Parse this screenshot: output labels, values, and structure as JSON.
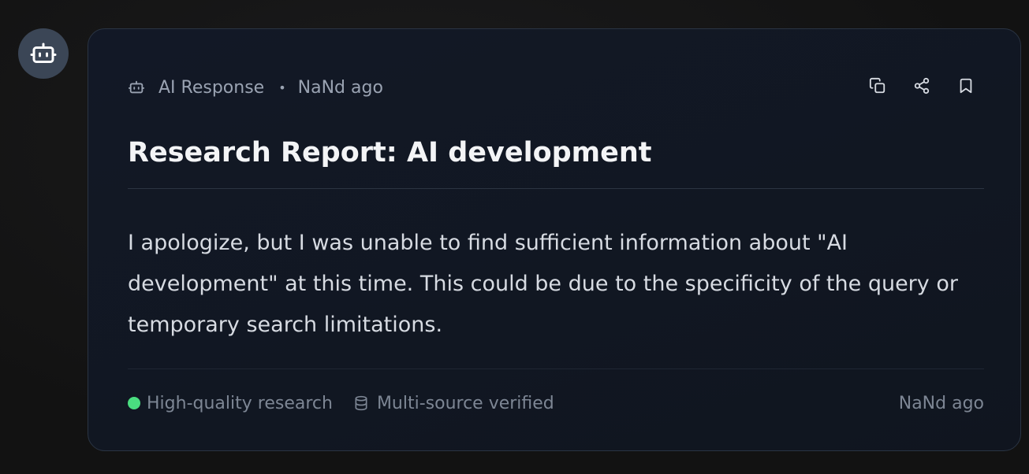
{
  "header": {
    "label": "AI Response",
    "separator": "•",
    "timestamp": "NaNd ago"
  },
  "actions": {
    "icons": [
      "copy-icon",
      "share-icon",
      "bookmark-icon"
    ]
  },
  "report": {
    "title": "Research Report: AI development",
    "body": "I apologize, but I was unable to find sufficient information about \"AI development\" at this time. This could be due to the specificity of the query or temporary search limitations."
  },
  "footer": {
    "quality": "High-quality research",
    "verified": "Multi-source verified",
    "timestamp": "NaNd ago"
  },
  "colors": {
    "accent_green": "#4ade80",
    "card_bg": "#121826",
    "avatar_bg": "#3b4656"
  }
}
